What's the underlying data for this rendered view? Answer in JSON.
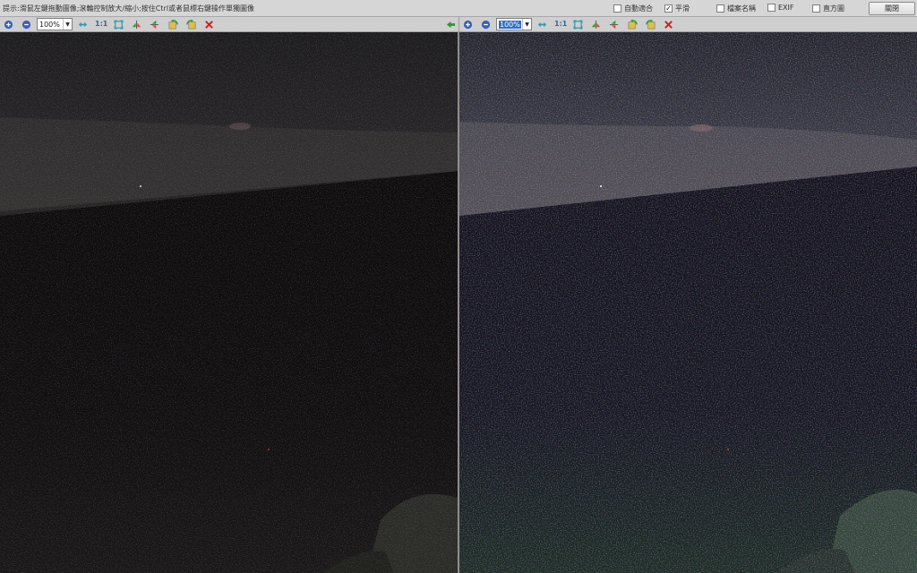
{
  "hint_text": "提示:滑鼠左鍵拖動圖像;滾輪控制放大/縮小;按住Ctrl或者鼠標右鍵操作單獨圖像",
  "options": {
    "auto_fit": {
      "label": "自動適合",
      "checked": false
    },
    "smooth": {
      "label": "平滑",
      "checked": true
    },
    "filename": {
      "label": "檔案名稱",
      "checked": false
    },
    "exif": {
      "label": "EXIF",
      "checked": false
    },
    "histogram": {
      "label": "直方圖",
      "checked": false
    }
  },
  "close_label": "關閉",
  "left_toolbar": {
    "zoom_value": "100%",
    "one_to_one": "1:1"
  },
  "right_toolbar": {
    "zoom_value": "100%",
    "one_to_one": "1:1"
  },
  "colors": {
    "zoom_in": "#3a5fbf",
    "fit_icon": "#2e9bb0",
    "rotate_green": "#2a9a2a",
    "close_red": "#d11a1a",
    "selection_blue": "#2f6fc9"
  }
}
